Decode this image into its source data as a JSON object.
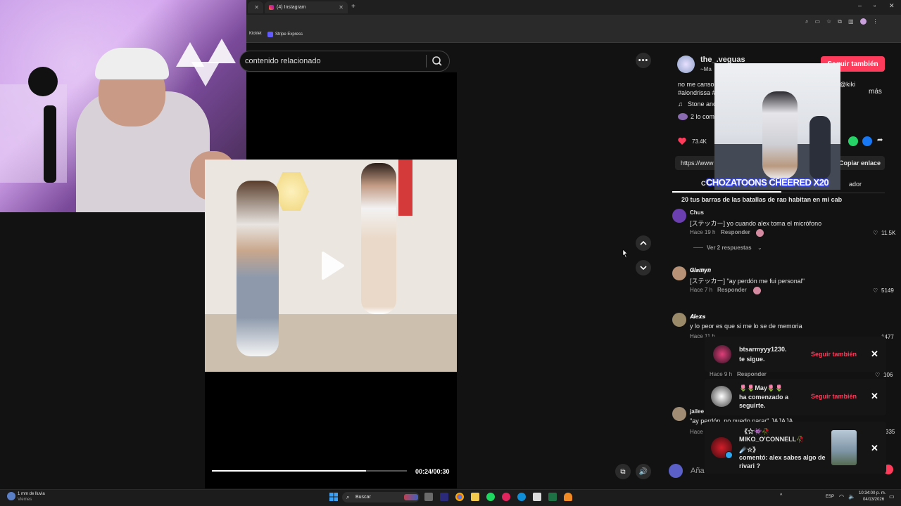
{
  "browser": {
    "tabs": [
      {
        "title": "(4) Instagram"
      }
    ],
    "new_tab_symbol": "+",
    "bookmarks": [
      "Kicklet",
      "Stripe Express"
    ]
  },
  "video": {
    "search_placeholder": "contenido relacionado",
    "time": "00:24/00:30",
    "progress": 0.79
  },
  "post": {
    "username": "the_.veguas",
    "subtitle": "~Ma",
    "follow_label": "Seguir también",
    "caption_line1": "no me canso",
    "caption_tag": "@kiki",
    "caption_line2": "#alondrissa #",
    "more_label": "más",
    "music": "Stone anc",
    "likes_text": "2 lo com",
    "like_count": "73.4K",
    "link_text": "https://www",
    "copy_link_label": "Copiar enlace",
    "tab_c": "C",
    "tab_creator": "ador",
    "top_comment_partial": "20 tus barras de las batallas de rap habitan en mi cab"
  },
  "overlay": {
    "cheer_text": "CHOZATOONS CHEERED X20"
  },
  "comments": [
    {
      "user": "Chus",
      "text": "[ステッカー] yo cuando alex toma el micrófono",
      "time": "Hace 19 h",
      "reply": "Responder",
      "likes": "11.5K",
      "replies_toggle": "Ver 2 respuestas"
    },
    {
      "user": "𝑮𝒊𝒔𝒎𝒚𝒏",
      "text": "[ステッカー] \"ay perdón me fui personal\"",
      "time": "Hace 7 h",
      "reply": "Responder",
      "likes": "5149"
    },
    {
      "user": "𝑨𝒍𝒆𝒙𝒔",
      "text": "y lo peor es que si me lo se de memoria",
      "time": "Hace 11 h",
      "reply": "Responder",
      "likes": "1477"
    },
    {
      "user": "",
      "text": "",
      "time": "Hace 9 h",
      "reply": "Responder",
      "likes": "106"
    },
    {
      "user": "jailee",
      "text": "\"ay perdón, no puedo parar\" JAJAJA",
      "time": "Hace",
      "reply": "",
      "likes": "335"
    }
  ],
  "comment_input": {
    "placeholder": "Aña"
  },
  "notifications": [
    {
      "line1": "btsarmyyy1230.",
      "line2": "te sigue.",
      "action": "Seguir también"
    },
    {
      "line1": "🌷🌷May🌷🌷",
      "line2": "ha comenzado a",
      "line3": "seguirte.",
      "action": "Seguir también"
    },
    {
      "line1": "《☆👾🥀",
      "line2": "MIKO_O'CONNELL🥀",
      "line3": "☄️☆》",
      "line4": "comentó: alex sabes algo de",
      "line5": "rivari ?"
    }
  ],
  "taskbar": {
    "weather_line1": "1 mm de lluvia",
    "weather_line2": "Viernes",
    "search_label": "Buscar",
    "lang": "ESP",
    "time": "10:34:00 p. m.",
    "date": "04/13/2026"
  },
  "colors": {
    "accent": "#ff3b5c",
    "background": "#121212"
  }
}
